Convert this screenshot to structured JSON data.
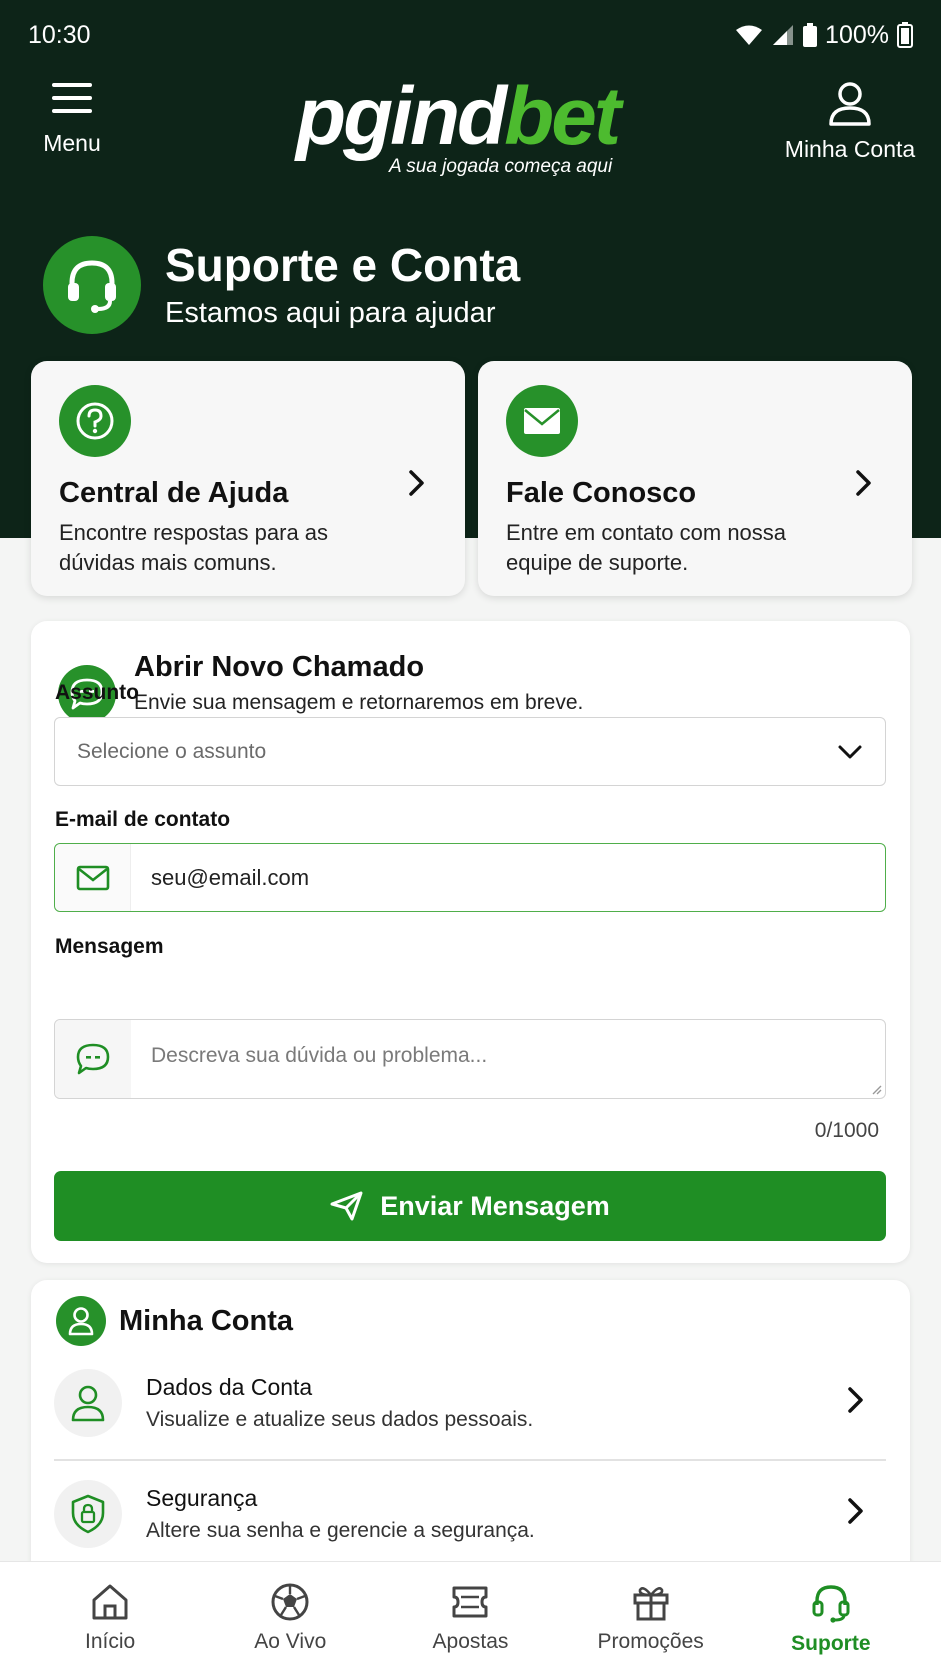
{
  "status_bar": {
    "time": "10:30",
    "battery": "100%"
  },
  "header": {
    "menu_label": "Menu",
    "logo_part1": "pgind",
    "logo_part2": "bet",
    "tagline": "A sua jogada começa aqui",
    "account_label": "Minha Conta"
  },
  "page": {
    "title": "Suporte e Conta",
    "subtitle": "Estamos aqui para ajudar"
  },
  "quick_cards": [
    {
      "title": "Central de Ajuda",
      "description": "Encontre respostas para as dúvidas mais comuns.",
      "icon": "question-circle-icon"
    },
    {
      "title": "Fale Conosco",
      "description": "Entre em contato com nossa equipe de suporte.",
      "icon": "envelope-icon"
    }
  ],
  "ticket_form": {
    "title": "Abrir Novo Chamado",
    "subtitle": "Envie sua mensagem e retornaremos em breve.",
    "subject_label": "Assunto",
    "subject_placeholder": "Selecione o assunto",
    "email_label": "E-mail de contato",
    "email_value": "seu@email.com",
    "message_label": "Mensagem",
    "message_placeholder": "Descreva sua dúvida ou problema...",
    "counter": "0/1000",
    "submit_label": "Enviar Mensagem"
  },
  "account_section": {
    "title": "Minha Conta",
    "items": [
      {
        "title": "Dados da Conta",
        "description": "Visualize e atualize seus dados pessoais.",
        "icon": "user-icon"
      },
      {
        "title": "Segurança",
        "description": "Altere sua senha e gerencie a segurança.",
        "icon": "shield-lock-icon"
      }
    ]
  },
  "bottom_nav": {
    "items": [
      {
        "label": "Início",
        "icon": "home-icon"
      },
      {
        "label": "Ao Vivo",
        "icon": "soccer-ball-icon"
      },
      {
        "label": "Apostas",
        "icon": "ticket-icon"
      },
      {
        "label": "Promoções",
        "icon": "gift-icon"
      },
      {
        "label": "Suporte",
        "icon": "headset-icon"
      }
    ],
    "active_index": 4
  },
  "colors": {
    "header_bg": "#0d2418",
    "accent_green": "#1f8e24",
    "logo_green": "#4dbb2f"
  }
}
